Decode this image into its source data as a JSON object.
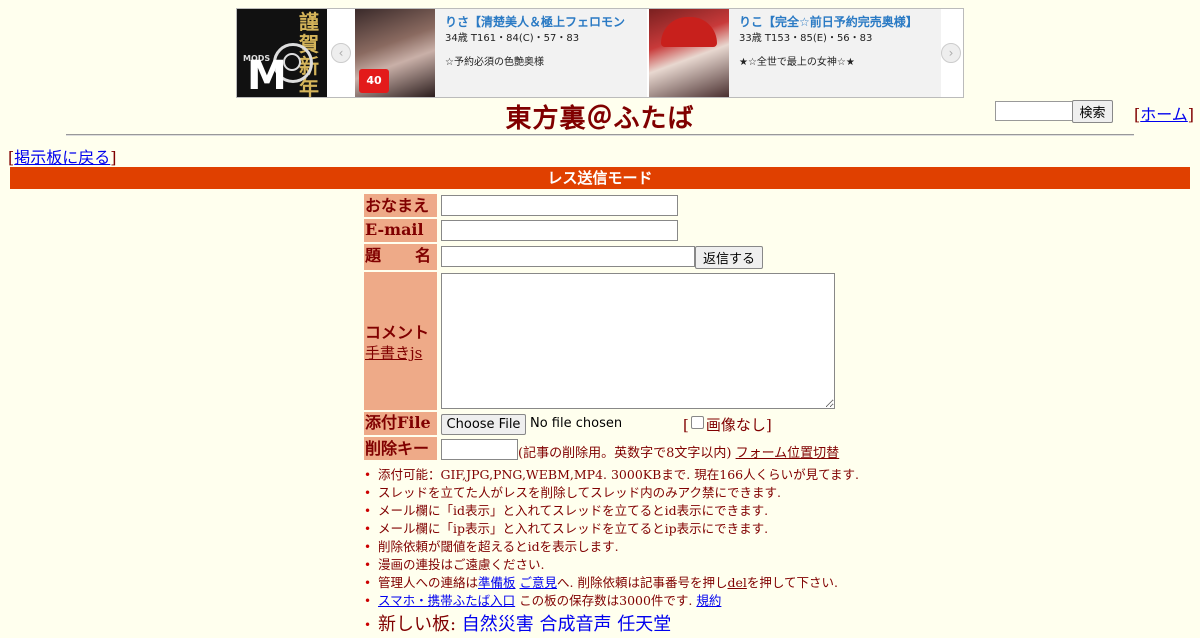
{
  "ad": {
    "logo_small_text": "MODS",
    "logo_letter": "M",
    "logo_greeting": "謹賀新年",
    "cards": [
      {
        "name": "りさ【清楚美人＆極上フェロモン",
        "stats": "34歳 T161・84(C)・57・83",
        "catch": "☆予約必須の色艶奥様",
        "badge": "40"
      },
      {
        "name": "りこ【完全☆前日予約完売奥様】",
        "stats": "33歳 T153・85(E)・56・83",
        "catch": "★☆全世で最上の女神☆★"
      }
    ],
    "prev_arrow": "‹",
    "next_arrow": "›"
  },
  "header": {
    "title": "東方裏＠ふたば",
    "search_button": "検索",
    "home_open": "[",
    "home_label": "ホーム",
    "home_close": "]",
    "back_open": "[",
    "back_label": "掲示板に戻る",
    "back_close": "]"
  },
  "mode_bar": "レス送信モード",
  "form": {
    "name_label": "おなまえ",
    "email_label": "E-mail",
    "subject_label_1": "題",
    "subject_label_2": "名",
    "reply_button": "返信する",
    "comment_label": "コメント",
    "handwrite_link": "手書きjs",
    "file_label": "添付File",
    "choose_file_button": "Choose File",
    "no_file_text": "No file chosen",
    "noimage_open": "[",
    "noimage_label": "画像なし]",
    "delkey_label": "削除キー",
    "delkey_note": "(記事の削除用。英数字で8文字以内)",
    "form_position_link": "フォーム位置切替"
  },
  "rules": {
    "r1": "添付可能：GIF,JPG,PNG,WEBM,MP4. 3000KBまで. 現在166人くらいが見てます.",
    "r2": "スレッドを立てた人がレスを削除してスレッド内のみアク禁にできます.",
    "r3": "メール欄に「id表示」と入れてスレッドを立てるとid表示にできます.",
    "r4": "メール欄に「ip表示」と入れてスレッドを立てるとip表示にできます.",
    "r5": "削除依頼が閾値を超えるとidを表示します.",
    "r6": "漫画の連投はご遠慮ください.",
    "r7_prefix": "管理人への連絡は",
    "r7_link1": "準備板",
    "r7_link2": "ご意見",
    "r7_mid": "へ. 削除依頼は記事番号を押し",
    "r7_link3": "del",
    "r7_suffix": "を押して下さい.",
    "r8_link": "スマホ・携帯ふたば入口",
    "r8_mid": " この板の保存数は3000件です. ",
    "r8_link2": "規約",
    "new_boards_label": "新しい板: ",
    "new_boards": [
      "自然災害",
      "合成音声",
      "任天堂"
    ]
  }
}
